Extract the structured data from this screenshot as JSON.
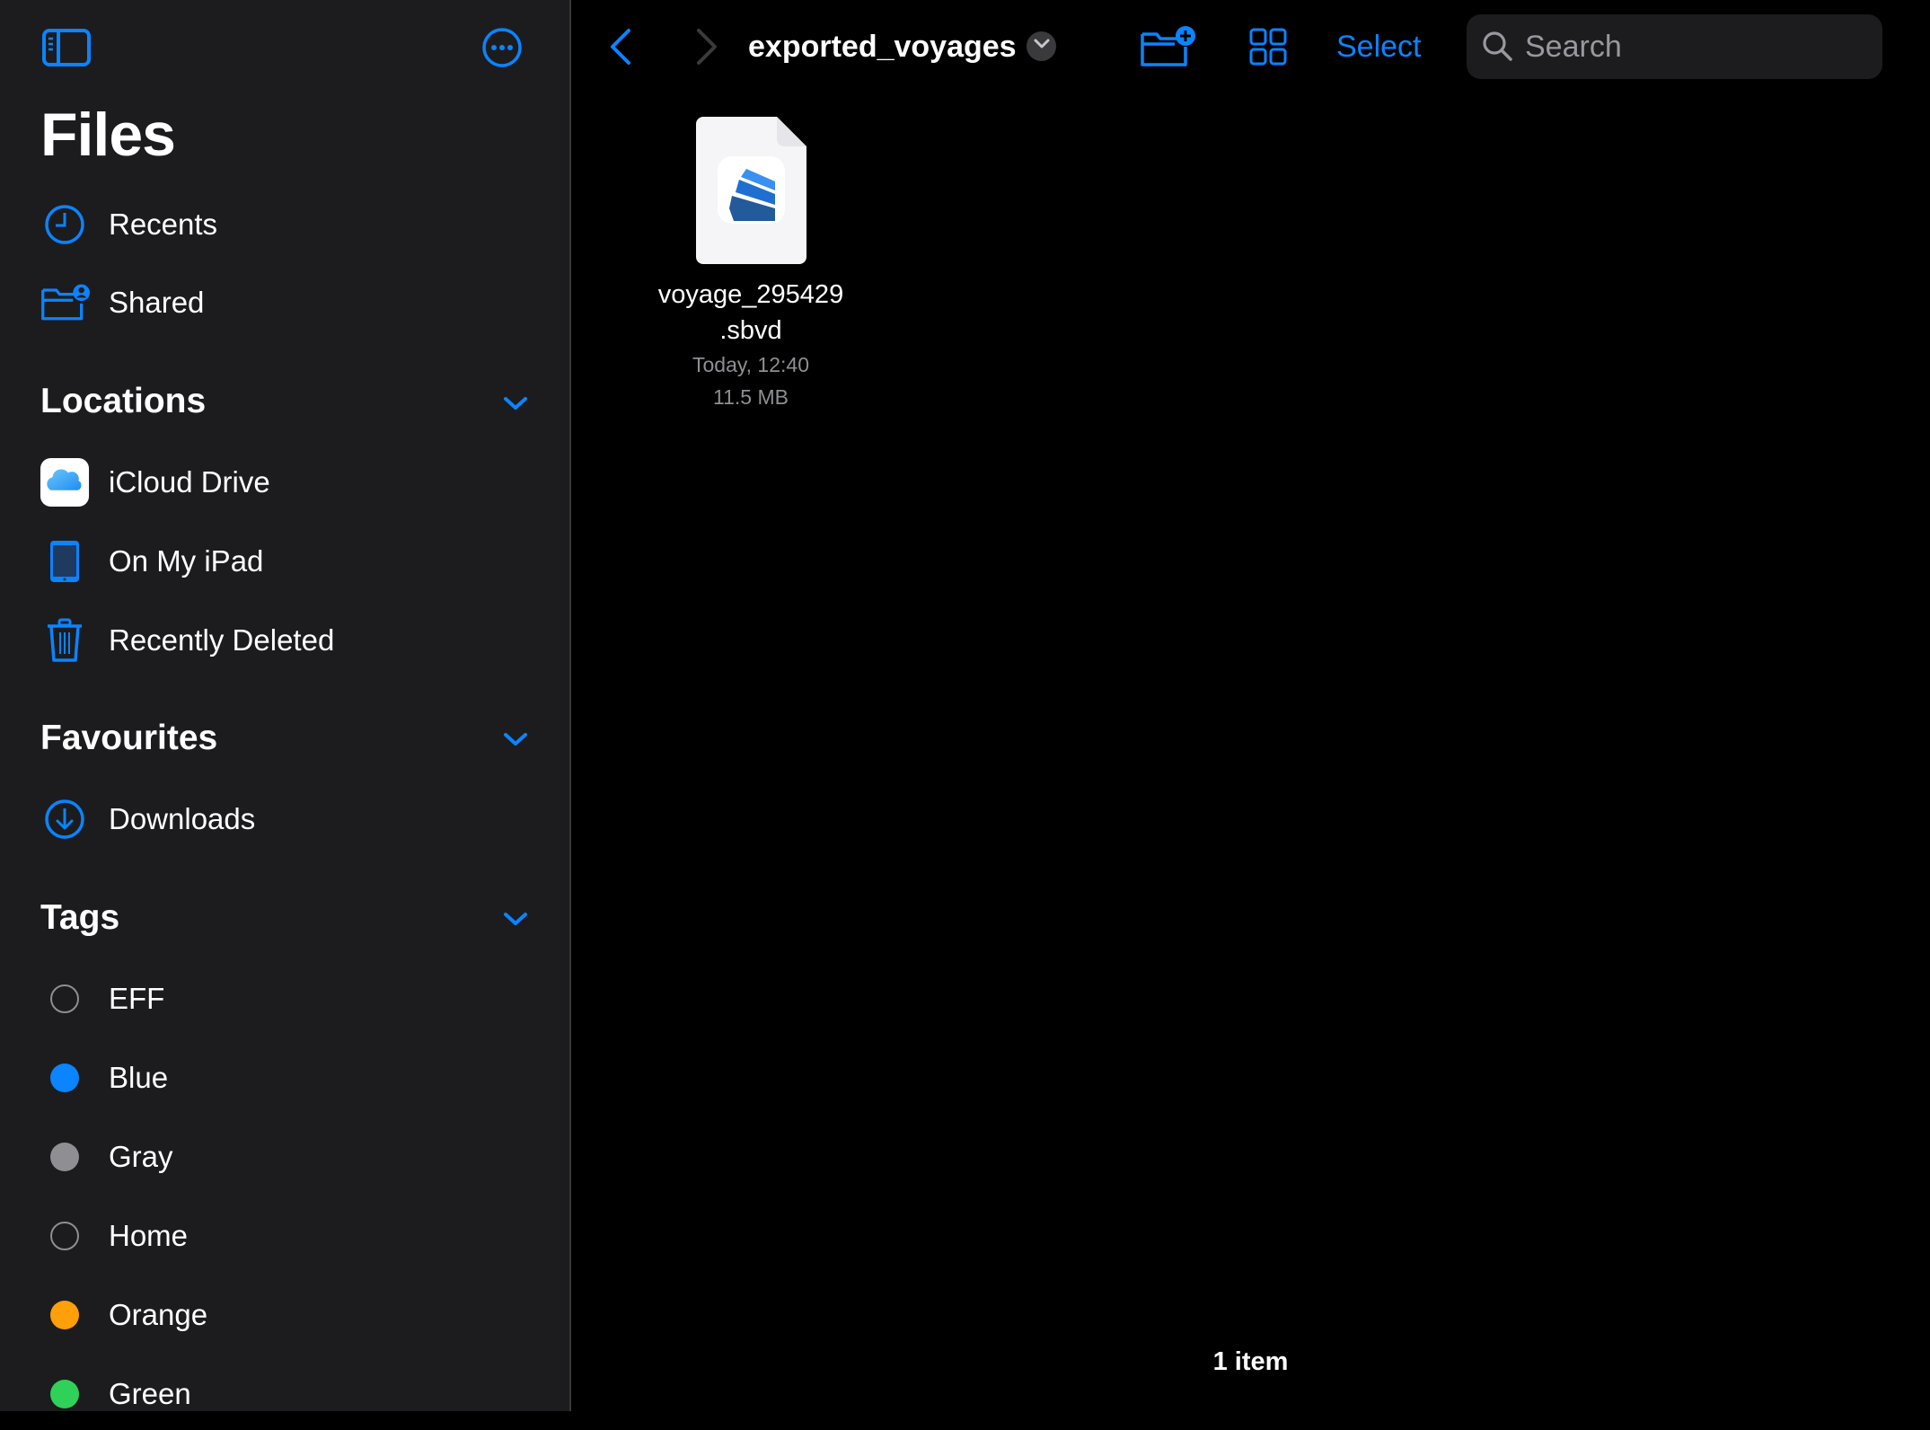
{
  "app": {
    "title": "Files"
  },
  "sidebar": {
    "toggle_icon": "sidebar-left-icon",
    "more_icon": "ellipsis-circle-icon",
    "top_items": [
      {
        "label": "Recents",
        "icon": "clock-icon"
      },
      {
        "label": "Shared",
        "icon": "shared-folder-icon"
      }
    ],
    "sections": {
      "locations": {
        "title": "Locations",
        "items": [
          {
            "label": "iCloud Drive",
            "icon": "icloud-icon"
          },
          {
            "label": "On My iPad",
            "icon": "ipad-icon"
          },
          {
            "label": "Recently Deleted",
            "icon": "trash-icon"
          }
        ]
      },
      "favourites": {
        "title": "Favourites",
        "items": [
          {
            "label": "Downloads",
            "icon": "download-circle-icon"
          }
        ]
      },
      "tags": {
        "title": "Tags",
        "items": [
          {
            "label": "EFF",
            "color": "",
            "outline": true
          },
          {
            "label": "Blue",
            "color": "#0a84ff",
            "outline": false
          },
          {
            "label": "Gray",
            "color": "#8e8e93",
            "outline": false
          },
          {
            "label": "Home",
            "color": "",
            "outline": true
          },
          {
            "label": "Orange",
            "color": "#ff9f0a",
            "outline": false
          },
          {
            "label": "Green",
            "color": "#30d158",
            "outline": false
          }
        ]
      }
    }
  },
  "toolbar": {
    "folder_title": "exported_voyages",
    "select_label": "Select",
    "search_placeholder": "Search",
    "search_value": ""
  },
  "content": {
    "files": [
      {
        "name_line1": "voyage_295429",
        "name_line2": ".sbvd",
        "modified": "Today, 12:40",
        "size": "11.5 MB"
      }
    ],
    "item_count": "1 item"
  },
  "colors": {
    "accent": "#0a84ff",
    "sidebar_bg": "#1c1c1e",
    "main_bg": "#000000",
    "secondary_text": "#8e8e93"
  }
}
